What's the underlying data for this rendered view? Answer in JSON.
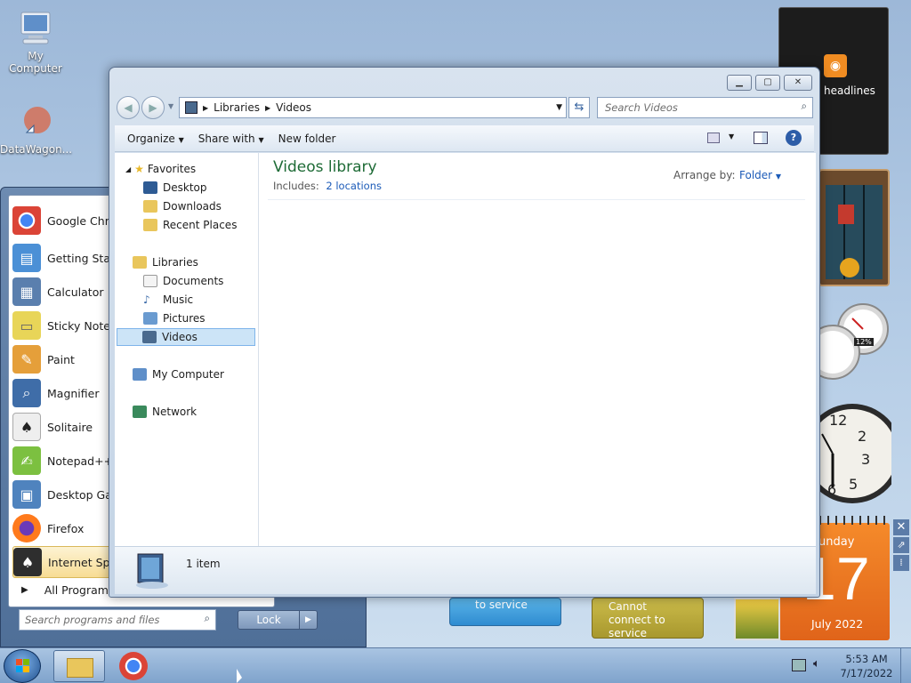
{
  "desktop": {
    "icons": [
      {
        "label": "My Computer"
      },
      {
        "label": "DataWagon..."
      }
    ]
  },
  "gadgets": {
    "feed_label": "headlines",
    "weather1_text": "to service",
    "weather2_text": "Cannot connect to service",
    "calendar": {
      "weekday": "unday",
      "day": "17",
      "month_year": "July 2022"
    },
    "cpu_meter": "12%"
  },
  "start_menu": {
    "items": [
      {
        "label": "Google Chrome",
        "color": "#db4437"
      },
      {
        "label": "Getting Started",
        "color": "#4b90d6"
      },
      {
        "label": "Calculator",
        "color": "#5a7fae"
      },
      {
        "label": "Sticky Notes",
        "color": "#e8d558"
      },
      {
        "label": "Paint",
        "color": "#e59f3a"
      },
      {
        "label": "Magnifier",
        "color": "#3f6da8"
      },
      {
        "label": "Solitaire",
        "color": "#c7c7c7"
      },
      {
        "label": "Notepad++",
        "color": "#7cc040"
      },
      {
        "label": "Desktop Gadgets",
        "color": "#4f83be"
      },
      {
        "label": "Firefox",
        "color": "#ff7a1c"
      },
      {
        "label": "Internet Spades",
        "color": "#2e2e2e"
      }
    ],
    "all_programs": "All Programs",
    "search_placeholder": "Search programs and files",
    "lock_label": "Lock"
  },
  "explorer": {
    "breadcrumb": [
      "Libraries",
      "Videos"
    ],
    "search_placeholder": "Search Videos",
    "commands": {
      "organize": "Organize",
      "share_with": "Share with",
      "new_folder": "New folder"
    },
    "nav": {
      "favorites": "Favorites",
      "favorites_items": [
        "Desktop",
        "Downloads",
        "Recent Places"
      ],
      "libraries": "Libraries",
      "libraries_items": [
        "Documents",
        "Music",
        "Pictures",
        "Videos"
      ],
      "my_computer": "My Computer",
      "network": "Network"
    },
    "library": {
      "title": "Videos library",
      "includes_label": "Includes:",
      "locations_link": "2 locations",
      "arrange_label": "Arrange by:",
      "arrange_value": "Folder"
    },
    "details": {
      "item_count": "1 item"
    }
  },
  "taskbar": {
    "time": "5:53 AM",
    "date": "7/17/2022"
  }
}
